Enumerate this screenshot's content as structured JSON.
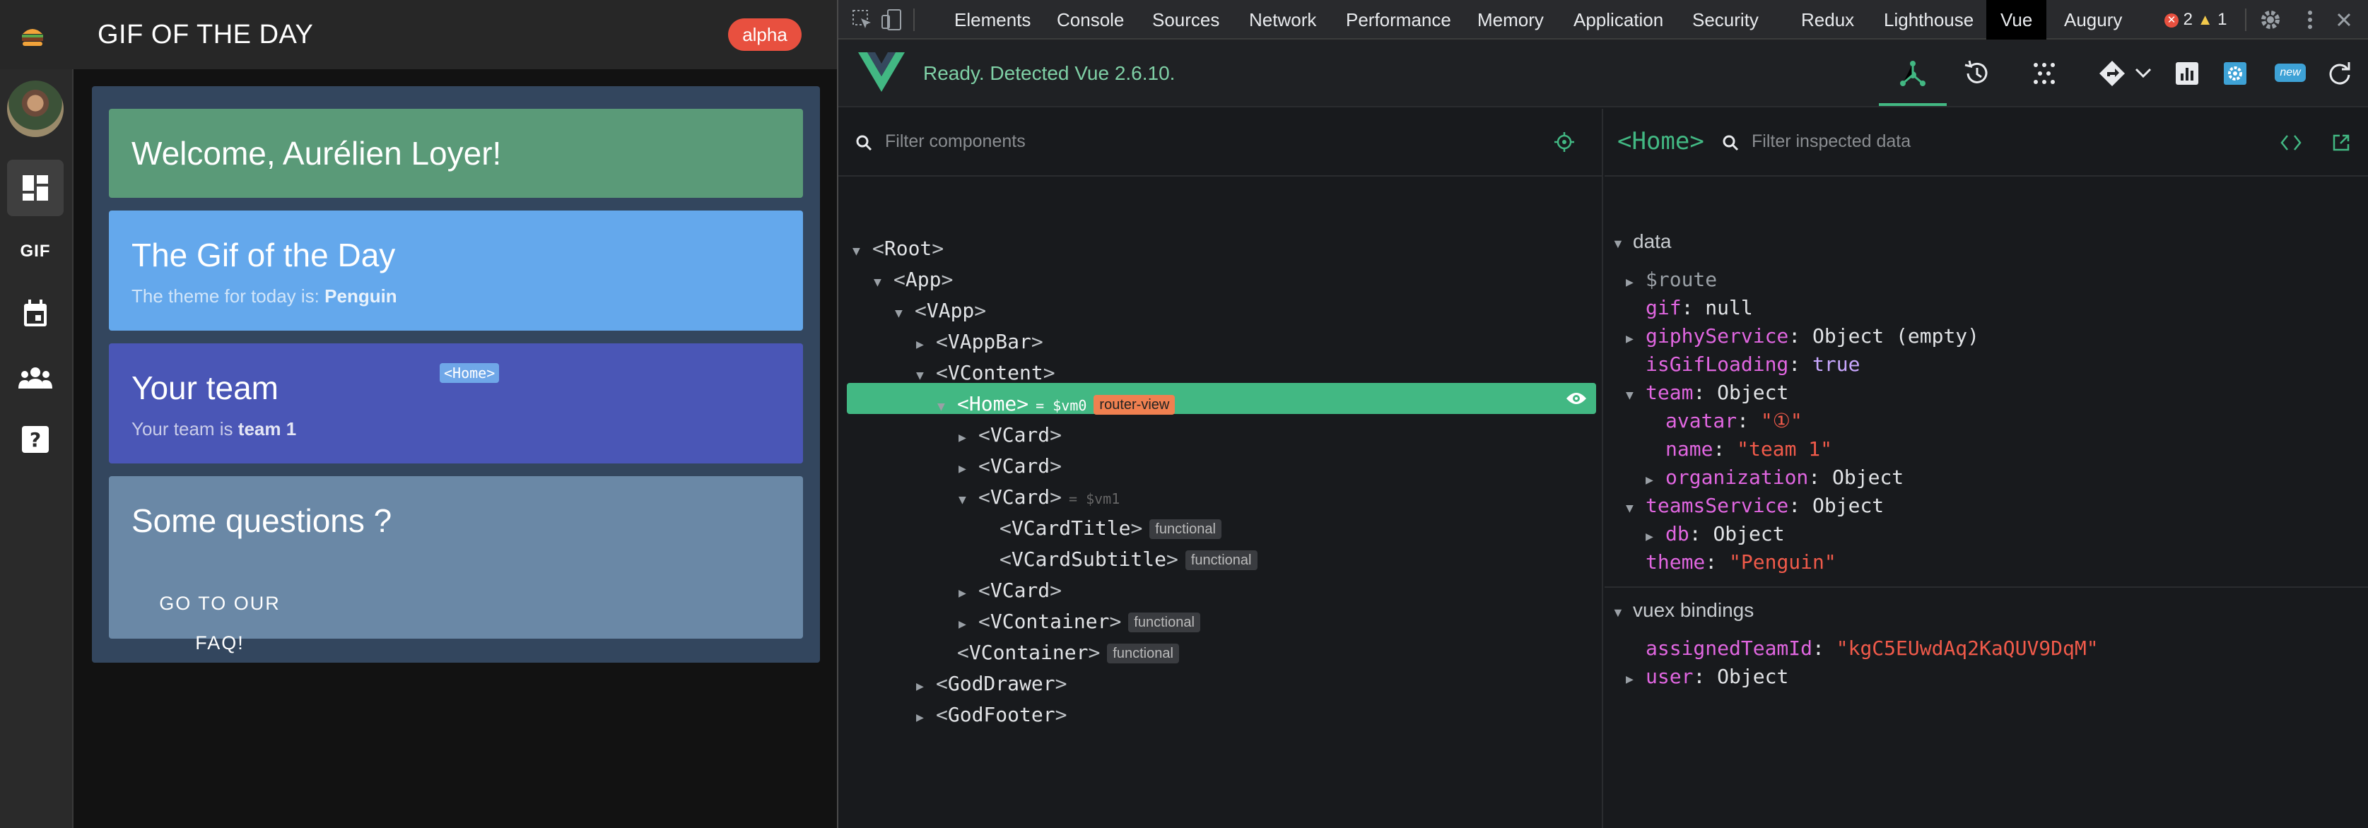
{
  "app": {
    "title": "GIF OF THE DAY",
    "env_badge": "alpha",
    "nav": [
      {
        "name": "dashboard-icon",
        "active": true
      },
      {
        "name": "gif-icon",
        "label": "GIF"
      },
      {
        "name": "calendar-icon"
      },
      {
        "name": "team-icon"
      },
      {
        "name": "help-icon"
      }
    ],
    "cards": {
      "welcome": {
        "title": "Welcome, Aurélien Loyer!"
      },
      "gif": {
        "title": "The Gif of the Day",
        "subtitle_prefix": "The theme for today is: ",
        "subtitle_value": "Penguin"
      },
      "team": {
        "title": "Your team",
        "subtitle_prefix": "Your team is ",
        "subtitle_value": "team 1",
        "highlight_tag": "<Home>"
      },
      "faq": {
        "title": "Some questions ?",
        "button": "GO TO OUR FAQ!"
      }
    }
  },
  "devtools": {
    "tabs": [
      "Elements",
      "Console",
      "Sources",
      "Network",
      "Performance",
      "Memory",
      "Application",
      "Security",
      "Redux",
      "Lighthouse",
      "Vue",
      "Augury"
    ],
    "active_tab": "Vue",
    "errors": "2",
    "warnings": "1",
    "vue": {
      "status": "Ready. Detected Vue 2.6.10.",
      "new_badge": "new",
      "components_placeholder": "Filter components",
      "inspected_placeholder": "Filter inspected data",
      "inspected_component": "<Home>",
      "tree": [
        {
          "indent": 0,
          "arrow": "▼",
          "name": "Root"
        },
        {
          "indent": 1,
          "arrow": "▼",
          "name": "App"
        },
        {
          "indent": 2,
          "arrow": "▼",
          "name": "VApp"
        },
        {
          "indent": 3,
          "arrow": "▶",
          "name": "VAppBar"
        },
        {
          "indent": 3,
          "arrow": "▼",
          "name": "VContent"
        },
        {
          "indent": 4,
          "arrow": "▼",
          "name": "Home",
          "vm": "= $vm0",
          "badge": "router-view",
          "selected": true
        },
        {
          "indent": 5,
          "arrow": "▶",
          "name": "VCard"
        },
        {
          "indent": 5,
          "arrow": "▶",
          "name": "VCard"
        },
        {
          "indent": 5,
          "arrow": "▼",
          "name": "VCard",
          "vm": "= $vm1"
        },
        {
          "indent": 6,
          "arrow": "",
          "name": "VCardTitle",
          "badge": "functional"
        },
        {
          "indent": 6,
          "arrow": "",
          "name": "VCardSubtitle",
          "badge": "functional"
        },
        {
          "indent": 5,
          "arrow": "▶",
          "name": "VCard"
        },
        {
          "indent": 5,
          "arrow": "▶",
          "name": "VContainer",
          "badge": "functional"
        },
        {
          "indent": 4,
          "arrow": "",
          "name": "VContainer",
          "badge": "functional"
        },
        {
          "indent": 3,
          "arrow": "▶",
          "name": "GodDrawer"
        },
        {
          "indent": 3,
          "arrow": "▶",
          "name": "GodFooter"
        }
      ],
      "data_section": "data",
      "data_props": [
        {
          "indent": 1,
          "arrow": "▶",
          "key": "$route",
          "dim": true
        },
        {
          "indent": 1,
          "arrow": "",
          "key": "gif",
          "value": "null",
          "kind": "plain"
        },
        {
          "indent": 1,
          "arrow": "▶",
          "key": "giphyService",
          "value": "Object (empty)",
          "kind": "plain"
        },
        {
          "indent": 1,
          "arrow": "",
          "key": "isGifLoading",
          "value": "true",
          "kind": "kw"
        },
        {
          "indent": 1,
          "arrow": "▼",
          "key": "team",
          "value": "Object",
          "kind": "plain"
        },
        {
          "indent": 2,
          "arrow": "",
          "key": "avatar",
          "value": "\"①\"",
          "kind": "str"
        },
        {
          "indent": 2,
          "arrow": "",
          "key": "name",
          "value": "\"team 1\"",
          "kind": "str"
        },
        {
          "indent": 2,
          "arrow": "▶",
          "key": "organization",
          "value": "Object",
          "kind": "plain"
        },
        {
          "indent": 1,
          "arrow": "▼",
          "key": "teamsService",
          "value": "Object",
          "kind": "plain"
        },
        {
          "indent": 2,
          "arrow": "▶",
          "key": "db",
          "value": "Object",
          "kind": "plain"
        },
        {
          "indent": 1,
          "arrow": "",
          "key": "theme",
          "value": "\"Penguin\"",
          "kind": "str"
        }
      ],
      "vuex_section": "vuex bindings",
      "vuex_props": [
        {
          "indent": 1,
          "arrow": "",
          "key": "assignedTeamId",
          "value": "\"kgC5EUwdAq2KaQUV9DqM\"",
          "kind": "str"
        },
        {
          "indent": 1,
          "arrow": "▶",
          "key": "user",
          "value": "Object",
          "kind": "plain"
        }
      ]
    }
  }
}
